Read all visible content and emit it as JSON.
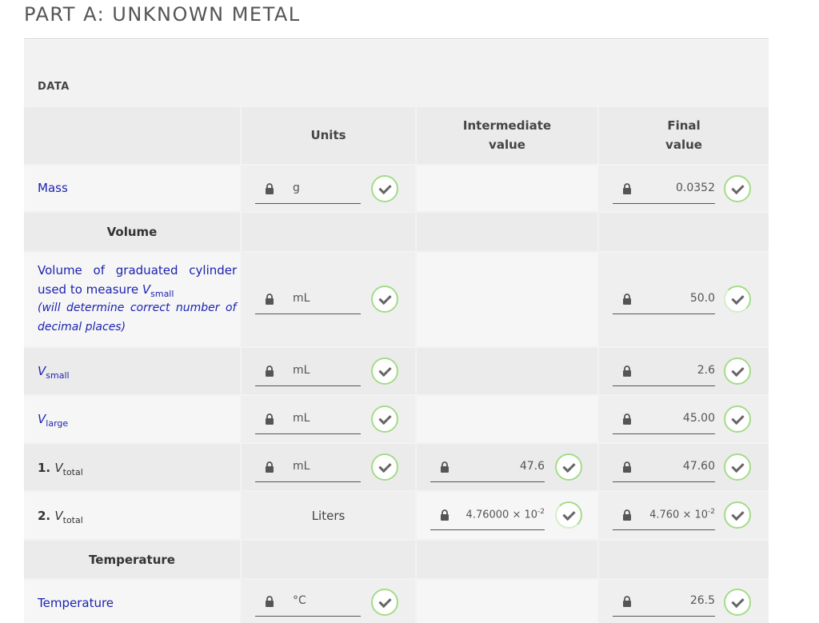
{
  "page_title": "PART A: UNKNOWN METAL",
  "data_label": "DATA",
  "headers": {
    "units": "Units",
    "intermediate_1": "Intermediate",
    "intermediate_2": "value",
    "final_1": "Final",
    "final_2": "value"
  },
  "rows": {
    "mass": {
      "label": "Mass",
      "units": "g",
      "final": "0.0352"
    },
    "volume_section": "Volume",
    "grad_cyl": {
      "label_1": "Volume of graduated cylinder",
      "label_2": "used to measure ",
      "label_v": "V",
      "label_sub": "small",
      "label_3": "(will determine correct number of",
      "label_4": "decimal places)",
      "units": "mL",
      "final": "50.0"
    },
    "vsmall": {
      "v": "V",
      "sub": "small",
      "units": "mL",
      "final": "2.6"
    },
    "vlarge": {
      "v": "V",
      "sub": "large",
      "units": "mL",
      "final": "45.00"
    },
    "vtotal1": {
      "prefix": "1. ",
      "v": "V",
      "sub": "total",
      "units": "mL",
      "intermediate": "47.6",
      "final": "47.60"
    },
    "vtotal2": {
      "prefix": "2. ",
      "v": "V",
      "sub": "total",
      "units": "Liters",
      "intermediate_base": "4.76000 × 10",
      "intermediate_exp": "-2",
      "final_base": "4.760 × 10",
      "final_exp": "-2"
    },
    "temperature_section": "Temperature",
    "temperature": {
      "label": "Temperature",
      "units": "°C",
      "final": "26.5"
    }
  },
  "colors": {
    "label_blue": "#1b23b0",
    "check_green": "#a3dd88"
  },
  "icons": {
    "lock": "lock-icon",
    "check": "check-circle-icon"
  }
}
